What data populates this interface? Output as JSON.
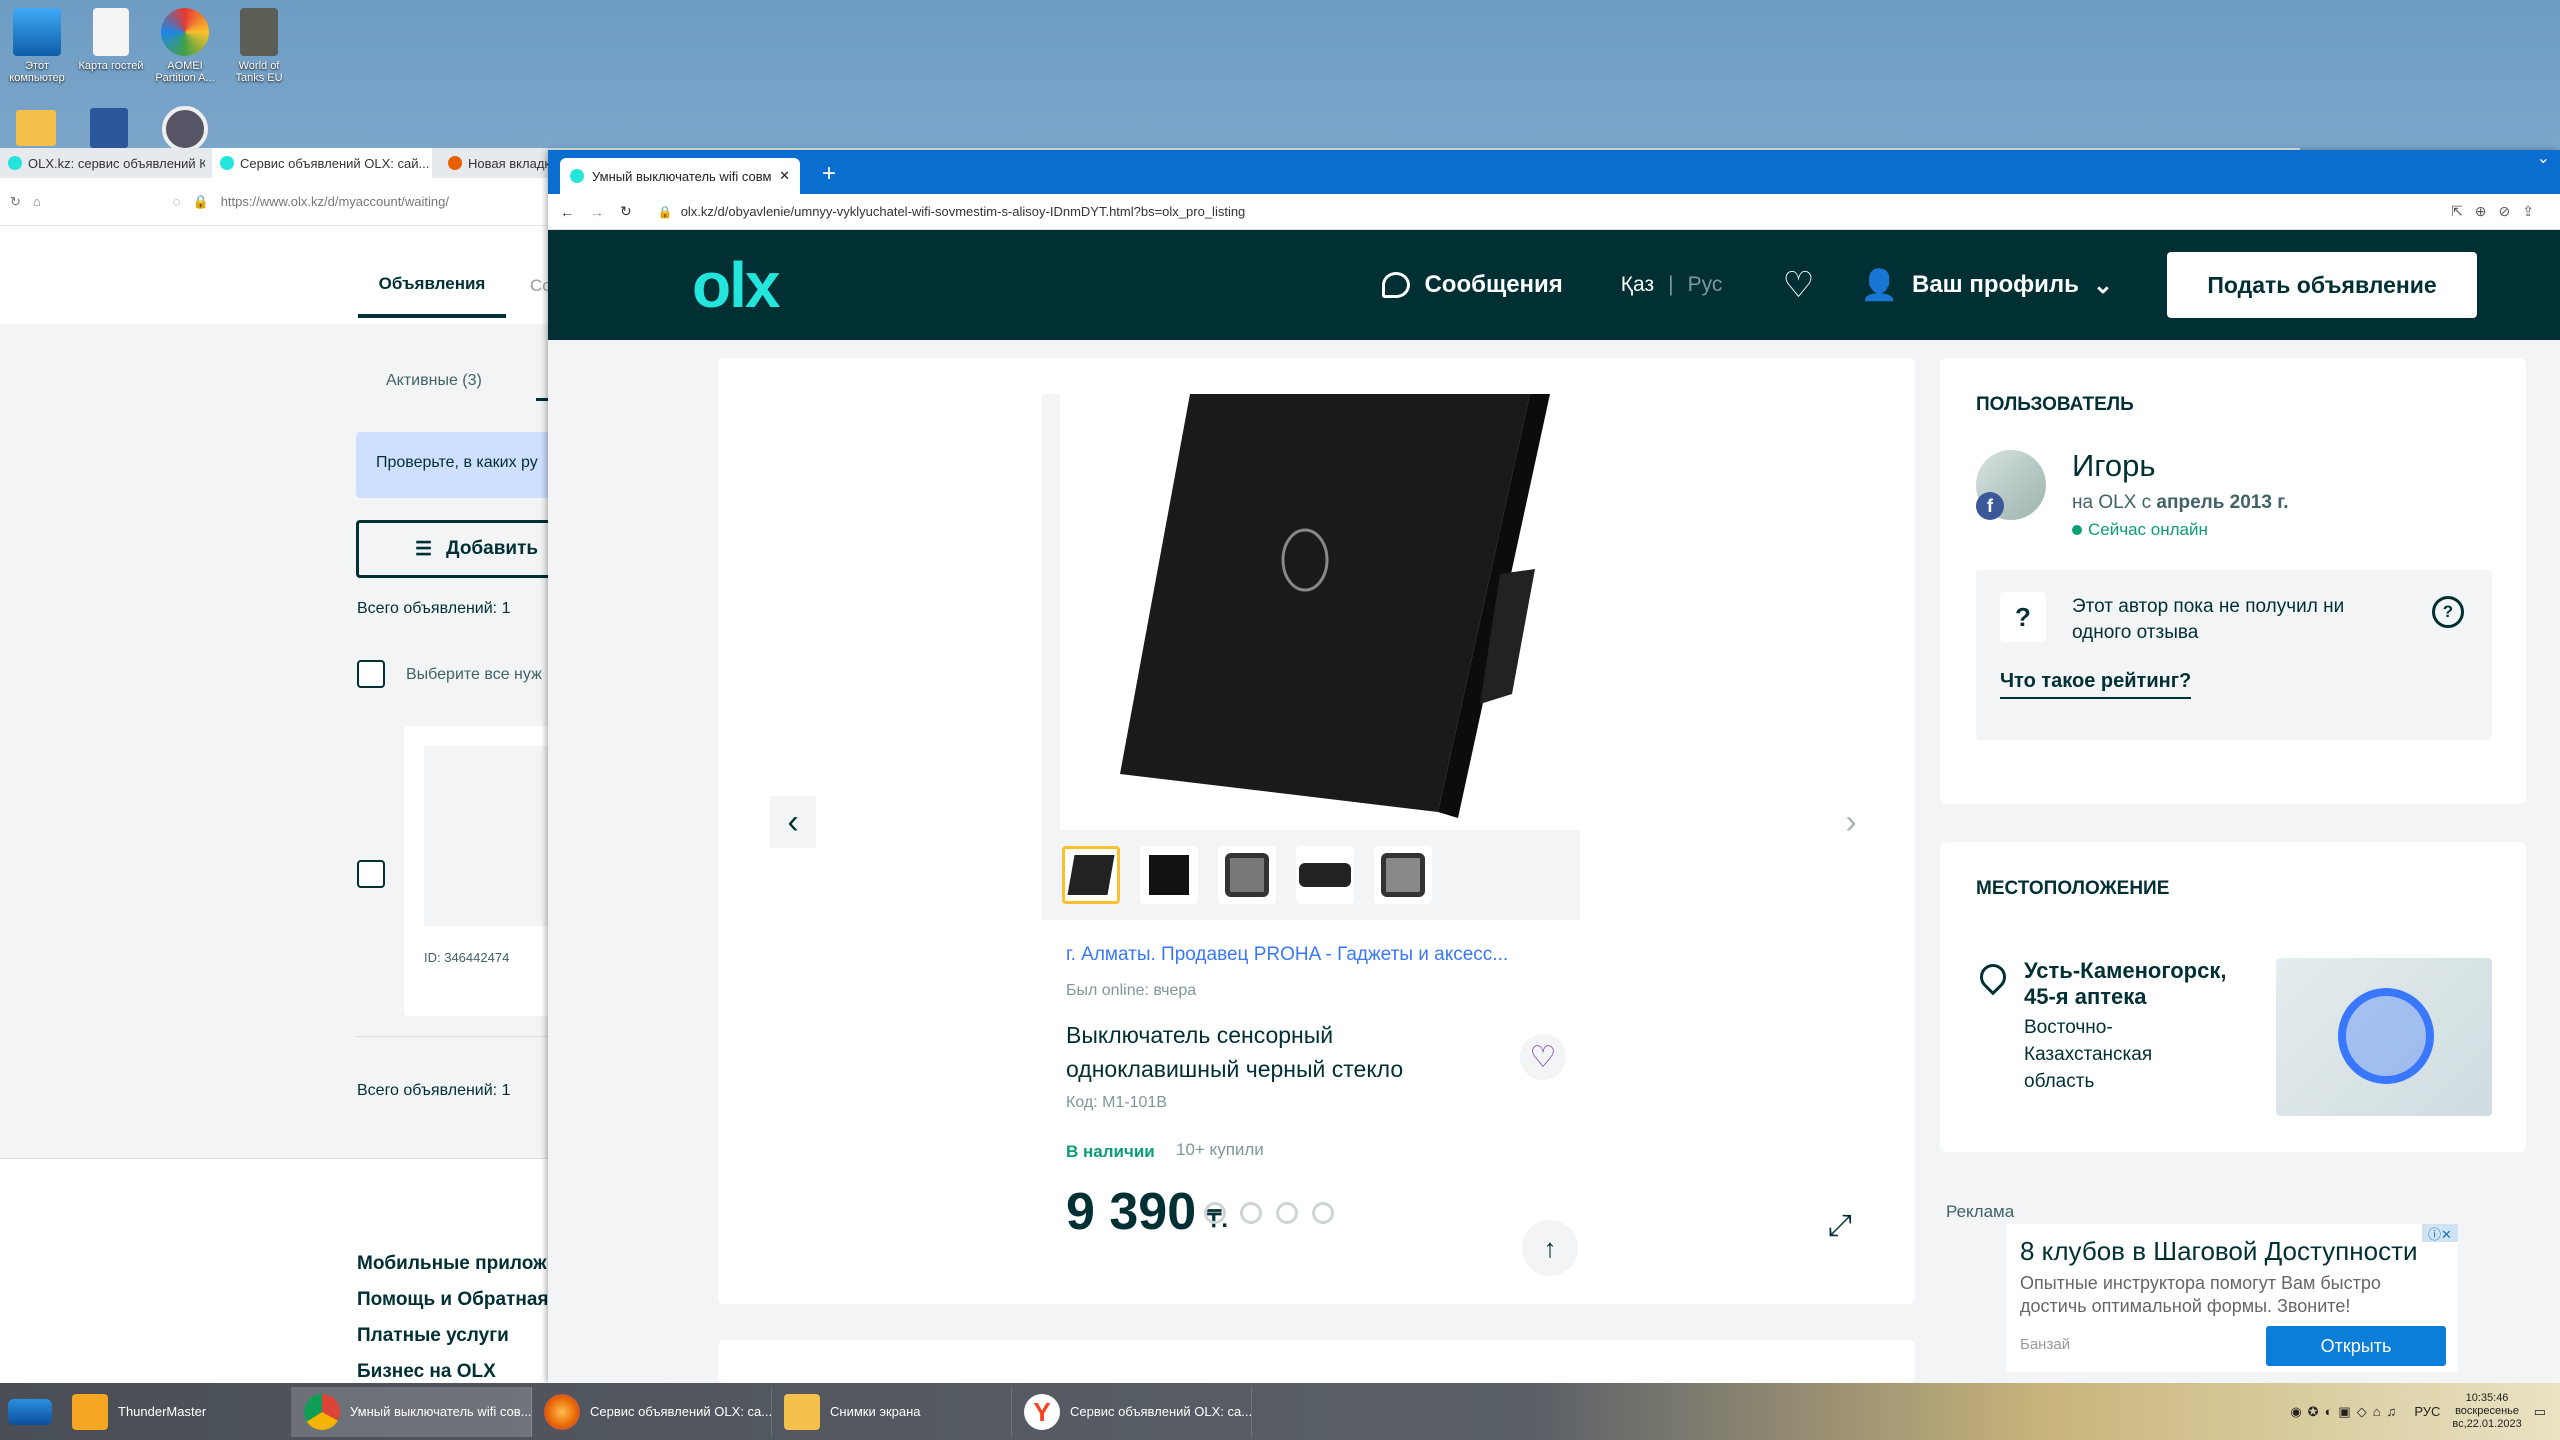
{
  "desktop": {
    "icons": [
      {
        "label": "Этот компьютер"
      },
      {
        "label": "Карта гостей"
      },
      {
        "label": "AOMEI Partition A..."
      },
      {
        "label": "World of Tanks EU"
      }
    ]
  },
  "back_browser": {
    "tabs": [
      "OLX.kz: сервис объявлений Ка...",
      "Сервис объявлений OLX: сай...",
      "Новая вкладка"
    ],
    "url": "https://www.olx.kz/d/myaccount/waiting/",
    "nav_tab_active": "Объявления",
    "nav_tab_next": "Со",
    "subtab_active": "Активные (3)",
    "info_text": "Проверьте, в каких ру",
    "add_button": "Добавить",
    "total_top": "Всего объявлений: 1",
    "select_all": "Выберите все нуж",
    "ad_id": "ID: 346442474",
    "total_bottom": "Всего объявлений: 1",
    "footer_links": [
      "Мобильные прилож",
      "Помощь и Обратная",
      "Платные услуги",
      "Бизнес на OLX"
    ]
  },
  "front_browser": {
    "tab_title": "Умный выключатель wifi совме...",
    "url": "olx.kz/d/obyavlenie/umnyy-vyklyuchatel-wifi-sovmestim-s-alisoy-IDnmDYT.html?bs=olx_pro_listing"
  },
  "header": {
    "logo": "olx",
    "messages": "Сообщения",
    "lang_kz": "Қаз",
    "lang_sep": "|",
    "lang_ru": "Рус",
    "profile": "Ваш профиль",
    "post_ad": "Подать объявление"
  },
  "listing": {
    "seller_line": "г. Алматы. Продавец PROHA - Гаджеты и аксесс...",
    "last_online": "Был online: вчера",
    "title": "Выключатель сенсорный одноклавишный черный стекло",
    "code": "Код: M1-101B",
    "in_stock": "В наличии",
    "bought": "10+ купили",
    "price": "9 390",
    "currency": "₸."
  },
  "user_card": {
    "section": "ПОЛЬЗОВАТЕЛЬ",
    "name": "Игорь",
    "since_prefix": "на OLX с",
    "since": "апрель 2013 г.",
    "online": "Сейчас онлайн",
    "rating_text": "Этот автор пока не получил ни одного отзыва",
    "rating_link": "Что такое рейтинг?"
  },
  "location_card": {
    "section": "МЕСТОПОЛОЖЕНИЕ",
    "city": "Усть-Каменогорск, 45-я аптека",
    "region": "Восточно-Казахстанская область"
  },
  "ad_block": {
    "label": "Реклама",
    "title": "8 клубов в Шаговой Доступности",
    "text": "Опытные инструктора помогут Вам быстро достичь оптимальной формы. Звоните!",
    "source": "Банзай",
    "button": "Открыть"
  },
  "taskbar": {
    "items": [
      "ThunderMaster",
      "Умный выключатель wifi сов...",
      "Сервис объявлений OLX: са...",
      "Снимки экрана",
      "Сервис объявлений OLX: са..."
    ],
    "lang": "РУС",
    "time": "10:35:46",
    "day": "воскресенье",
    "date": "вс,22.01.2023"
  },
  "colors": {
    "olx_dark": "#002f34",
    "olx_teal": "#23e5db",
    "link_blue": "#3a77ff",
    "online_green": "#0a9d76"
  }
}
